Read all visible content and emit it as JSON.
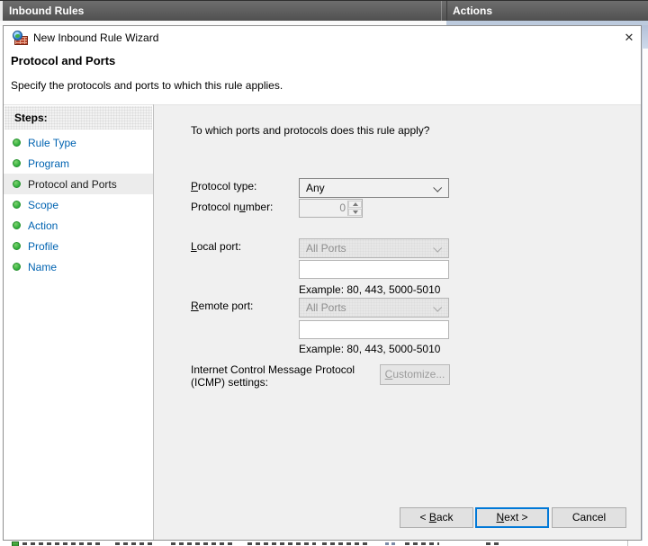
{
  "header": {
    "left_title": "Inbound Rules",
    "right_title": "Actions"
  },
  "wizard": {
    "title": "New Inbound Rule Wizard",
    "titlebar": {
      "close_glyph": "✕"
    },
    "heading": "Protocol and Ports",
    "subtitle": "Specify the protocols and ports to which this rule applies.",
    "steps": {
      "label": "Steps:",
      "items": [
        {
          "label": "Rule Type"
        },
        {
          "label": "Program"
        },
        {
          "label": "Protocol and Ports"
        },
        {
          "label": "Scope"
        },
        {
          "label": "Action"
        },
        {
          "label": "Profile"
        },
        {
          "label": "Name"
        }
      ]
    },
    "form": {
      "question": "To which ports and protocols does this rule apply?",
      "protocol_type": {
        "label_pre": "",
        "label_key": "P",
        "label_post": "rotocol type:",
        "value": "Any"
      },
      "protocol_number": {
        "label_pre": "Protocol n",
        "label_key": "u",
        "label_post": "mber:",
        "value": "0"
      },
      "local_port": {
        "label_pre": "",
        "label_key": "L",
        "label_post": "ocal port:",
        "value": "All Ports",
        "input_value": "",
        "example": "Example: 80, 443, 5000-5010"
      },
      "remote_port": {
        "label_pre": "",
        "label_key": "R",
        "label_post": "emote port:",
        "value": "All Ports",
        "input_value": "",
        "example": "Example: 80, 443, 5000-5010"
      },
      "icmp": {
        "label_line1": "Internet Control Message Protocol",
        "label_line2": "(ICMP) settings:",
        "button_key": "C",
        "button_post": "ustomize..."
      }
    },
    "footer": {
      "back_pre": "< ",
      "back_key": "B",
      "back_post": "ack",
      "next_key": "N",
      "next_post": "ext >",
      "cancel": "Cancel"
    }
  },
  "colors": {
    "header_bar": "#575757",
    "focus_accent": "#0078d7",
    "step_link": "#0063b1",
    "step_bullet_green": "#2fae3c",
    "content_bg": "#f0f0f0",
    "actions_panel_blue": "#bccadd"
  }
}
